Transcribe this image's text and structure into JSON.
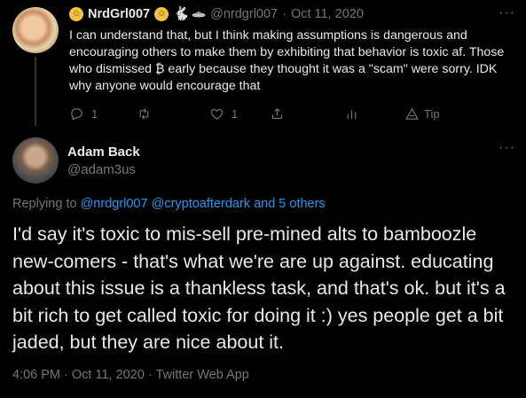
{
  "reply_context": {
    "name": "NrdGrl007",
    "handle": "@nrdgrl007",
    "separator": "·",
    "date": "Oct 11, 2020",
    "more": "···",
    "text": "I can understand that, but I think making assumptions is dangerous and encouraging others to make them by exhibiting that behavior is toxic af. Those who dismissed ₿ early because they thought it was a \"scam\" were sorry. IDK why anyone would encourage that",
    "actions": {
      "reply_count": "1",
      "retweet_count": "",
      "like_count": "1",
      "tip_label": "Tip"
    },
    "icons": {
      "emoji_1": "hugging-face-emoji",
      "emoji_2": "hugging-face-emoji",
      "emoji_3": "rabbit-emoji",
      "emoji_4": "flying-saucer-emoji"
    }
  },
  "tweet": {
    "name": "Adam Back",
    "handle": "@adam3us",
    "more": "···",
    "replying_prefix": "Replying to",
    "replying_user_1": "@nrdgrl007",
    "replying_user_2": "@cryptoafterdark",
    "replying_suffix": "and 5 others",
    "text": "I'd say it's toxic to mis-sell pre-mined alts to bamboozle new-comers - that's what we're are up against. educating about this issue is a thankless task, and that's ok. but it's a bit rich to get called toxic for doing it :) yes people get a bit jaded, but they are nice about it.",
    "time": "4:06 PM",
    "separator": "·",
    "date": "Oct 11, 2020",
    "client": "Twitter Web App"
  },
  "colors": {
    "background": "#000000",
    "text": "#e7e9ea",
    "secondary": "#71767b",
    "link": "#1d9bf0"
  }
}
